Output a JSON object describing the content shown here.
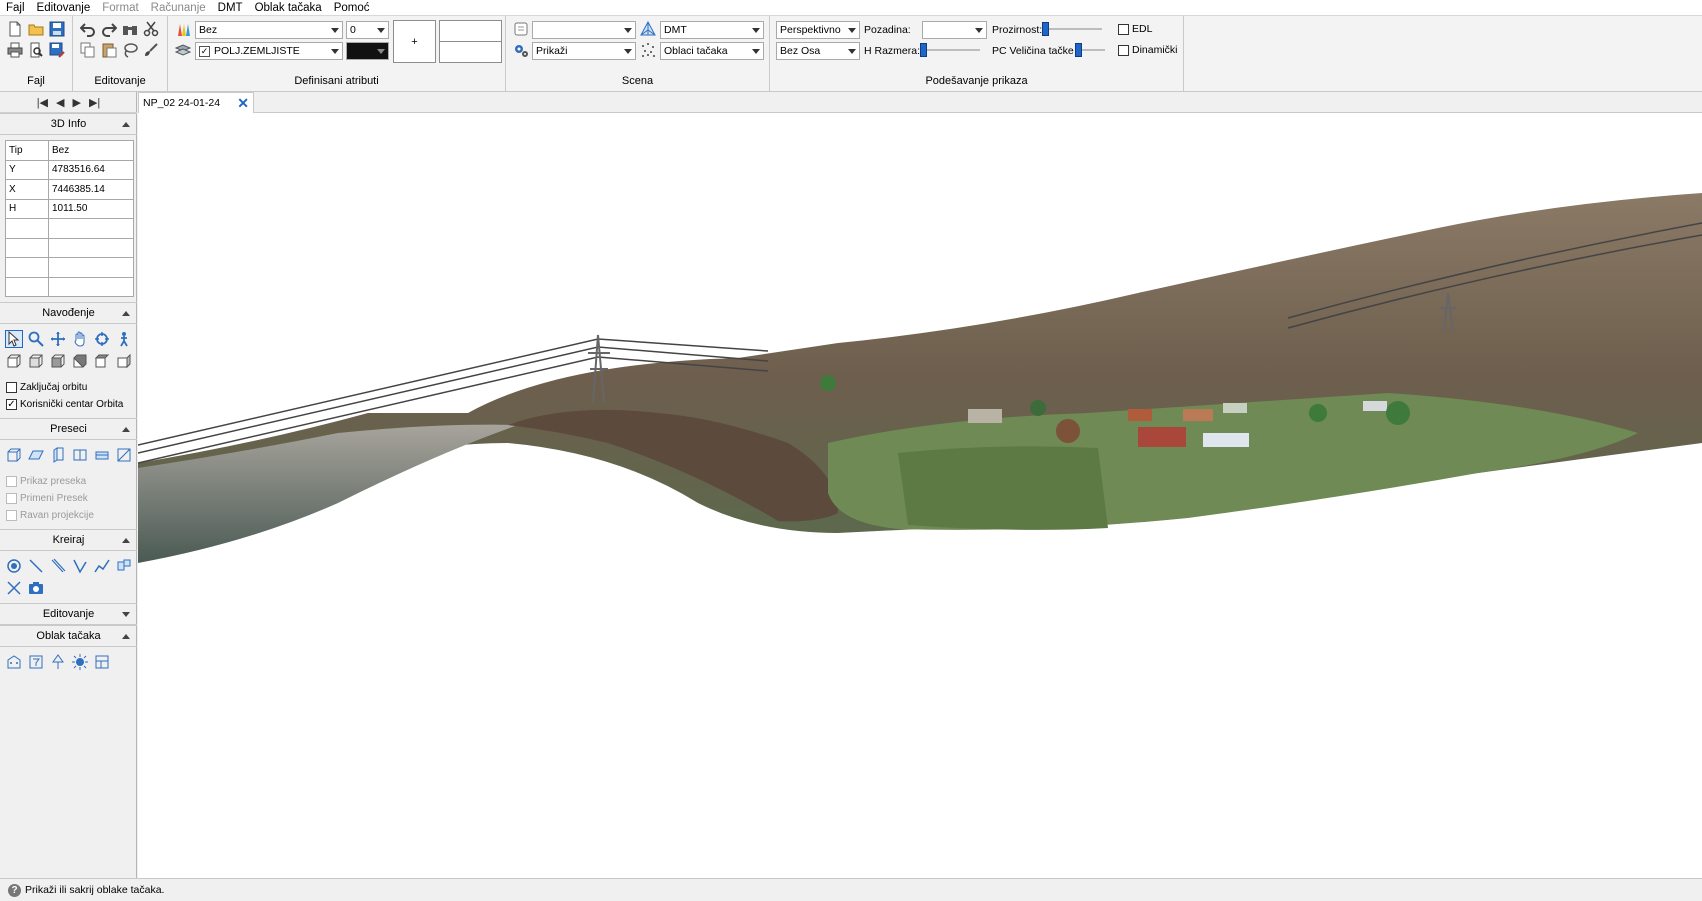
{
  "menu": [
    "Fajl",
    "Editovanje",
    "Format",
    "Računanje",
    "DMT",
    "Oblak tačaka",
    "Pomoć"
  ],
  "menu_disabled": [
    "Format",
    "Računanje"
  ],
  "ribbon": {
    "groups": {
      "fajl": "Fajl",
      "editovanje": "Editovanje",
      "definisani_atributi": "Definisani atributi",
      "scena": "Scena",
      "podesavanje": "Podešavanje prikaza"
    },
    "attributes": {
      "style_value": "Bez",
      "number_value": "0",
      "layer_value": "POLJ.ZEMLJISTE",
      "layer_checked": "✓",
      "plus_label": "+"
    },
    "scena": {
      "top_combo": "",
      "dmt_combo": "DMT",
      "prikazi_combo": "Prikaži",
      "oblaci_combo": "Oblaci tačaka"
    },
    "display": {
      "projection": "Perspektivno",
      "axes": "Bez Osa",
      "background_label": "Pozadina:",
      "background_value": "",
      "hscale_label": "H Razmera:",
      "transparency_label": "Prozirnost:",
      "pointsize_label": "PC Veličina tačke",
      "edl_label": "EDL",
      "dynamic_label": "Dinamički"
    }
  },
  "left_panel": {
    "info_title": "3D Info",
    "info_rows": [
      [
        "Tip",
        "Bez"
      ],
      [
        "Y",
        "4783516.64"
      ],
      [
        "X",
        "7446385.14"
      ],
      [
        "H",
        "1011.50"
      ],
      [
        "",
        ""
      ],
      [
        "",
        ""
      ],
      [
        "",
        ""
      ],
      [
        "",
        ""
      ]
    ],
    "navigation_title": "Navođenje",
    "lock_orbit": "Zaključaj orbitu",
    "user_orbit_center": "Korisnički centar Orbita",
    "user_orbit_center_checked": "✓",
    "sections_title": "Preseci",
    "show_section": "Prikaz preseka",
    "apply_section": "Primeni Presek",
    "projection_plane": "Ravan projekcije",
    "create_title": "Kreiraj",
    "edit_title": "Editovanje",
    "pointcloud_title": "Oblak tačaka"
  },
  "document_tab": "NP_02 24-01-24",
  "status": "Prikaži ili sakrij oblake tačaka.",
  "colors": {
    "accent": "#1e66c8",
    "layer_color": "#111111"
  },
  "icons": {
    "fajl": [
      "new-file-icon",
      "open-folder-icon",
      "save-icon",
      "print-icon",
      "print-preview-icon",
      "save-as-icon"
    ],
    "edit": [
      "undo-icon",
      "redo-icon",
      "binoculars-icon",
      "cut-icon",
      "copy-icon",
      "paste-icon",
      "lasso-icon",
      "brush-icon"
    ],
    "navigation": [
      "select-pointer-icon",
      "zoom-icon",
      "pan-icon",
      "hand-icon",
      "orbit-icon",
      "walk-person-icon"
    ],
    "views": [
      "view-front-icon",
      "view-back-icon",
      "view-left-icon",
      "view-right-icon",
      "view-top-icon",
      "view-bottom-icon"
    ]
  }
}
